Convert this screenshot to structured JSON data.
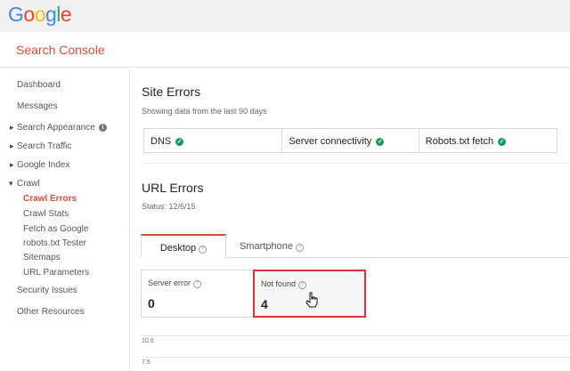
{
  "brand": {
    "logo_letters": [
      {
        "char": "G",
        "color": "#4285f4"
      },
      {
        "char": "o",
        "color": "#ea4335"
      },
      {
        "char": "o",
        "color": "#fbbc05"
      },
      {
        "char": "g",
        "color": "#4285f4"
      },
      {
        "char": "l",
        "color": "#34a853"
      },
      {
        "char": "e",
        "color": "#ea4335"
      }
    ],
    "product": "Search Console"
  },
  "sidebar": {
    "items": [
      {
        "label": "Dashboard"
      },
      {
        "label": "Messages"
      },
      {
        "label": "Search Appearance",
        "info_badge": "i"
      },
      {
        "label": "Search Traffic"
      },
      {
        "label": "Google Index"
      },
      {
        "label": "Crawl"
      },
      {
        "label": "Crawl Errors"
      },
      {
        "label": "Crawl Stats"
      },
      {
        "label": "Fetch as Google"
      },
      {
        "label": "robots.txt Tester"
      },
      {
        "label": "Sitemaps"
      },
      {
        "label": "URL Parameters"
      },
      {
        "label": "Security Issues"
      },
      {
        "label": "Other Resources"
      }
    ]
  },
  "site_errors": {
    "title": "Site Errors",
    "subtitle": "Showing data from the last 90 days",
    "cells": [
      {
        "label": "DNS",
        "status_icon": "check-circle"
      },
      {
        "label": "Server connectivity",
        "status_icon": "check-circle"
      },
      {
        "label": "Robots.txt fetch",
        "status_icon": "check-circle"
      }
    ]
  },
  "url_errors": {
    "title": "URL Errors",
    "status": "Status: 12/6/15",
    "tabs": [
      {
        "label": "Desktop",
        "help": "?"
      },
      {
        "label": "Smartphone",
        "help": "?"
      }
    ],
    "metrics": [
      {
        "label": "Server error",
        "help": "?",
        "value": "0"
      },
      {
        "label": "Not found",
        "help": "?",
        "value": "4"
      }
    ],
    "chart_ticks": [
      "10.0",
      "7.5"
    ]
  },
  "colors": {
    "accent": "#dd4b39",
    "success": "#0f9d58",
    "highlight_border": "#dd3333"
  }
}
